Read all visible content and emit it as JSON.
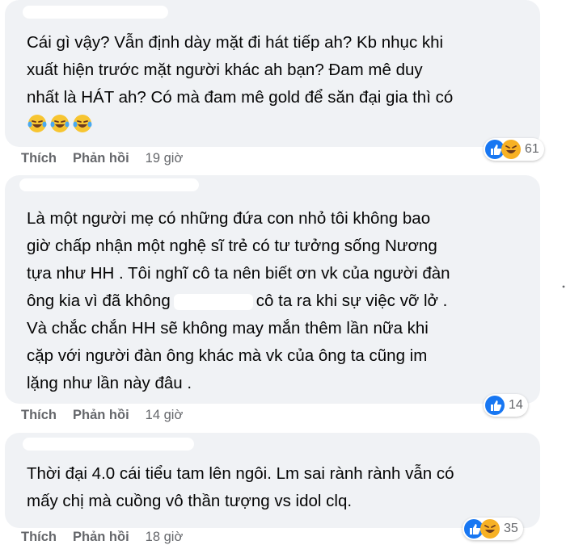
{
  "comments": [
    {
      "lines": [
        "Cái gì vậy? Vẫn định dày mặt đi hát tiếp ah? Kb nhục khi",
        "xuất hiện trước mặt người khác ah bạn? Đam mê duy",
        "nhất là HÁT ah? Có mà đam mê gold để săn đại gia thì có"
      ],
      "emoji": [
        "laugh-cry-emoji",
        "laugh-cry-emoji",
        "laugh-cry-emoji"
      ],
      "like_label": "Thích",
      "reply_label": "Phản hồi",
      "time": "19 giờ",
      "reactions": [
        "like",
        "haha"
      ],
      "reaction_count": "61"
    },
    {
      "lines": [
        "Là một người mẹ có những đứa con nhỏ tôi không bao",
        "giờ chấp nhận một nghệ sĩ trẻ có tư tưởng sống Nương",
        "tựa như HH . Tôi nghĩ cô ta nên biết ơn vk của người đàn"
      ],
      "line4_before": "ông kia vì đã không",
      "line4_after": "cô ta ra khi sự việc vỡ lở .",
      "lines_after": [
        "Và chắc chắn HH sẽ không may mắn thêm lần nữa khi",
        "cặp với người đàn ông khác mà vk của ông ta cũng im",
        "lặng như lần này đâu ."
      ],
      "like_label": "Thích",
      "reply_label": "Phản hồi",
      "time": "14 giờ",
      "reactions": [
        "like"
      ],
      "reaction_count": "14"
    },
    {
      "lines": [
        "Thời đại 4.0 cái tiểu tam lên ngôi. Lm sai rành rành vẫn có",
        "mấy chị mà cuồng vô thần tượng vs idol clq."
      ],
      "like_label": "Thích",
      "reply_label": "Phản hồi",
      "time": "18 giờ",
      "reactions": [
        "like",
        "haha"
      ],
      "reaction_count": "35"
    }
  ],
  "colors": {
    "bubble": "#f0f2f5",
    "text": "#050505",
    "meta": "#65676b",
    "like_blue": "#1877f2",
    "haha_yellow": "#f7b125"
  }
}
